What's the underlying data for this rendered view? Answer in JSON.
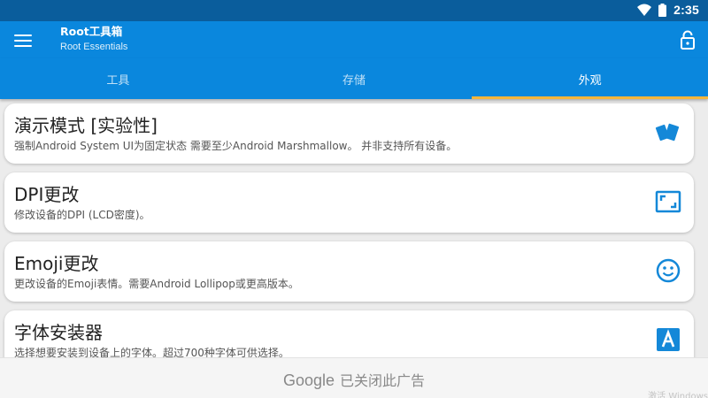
{
  "status": {
    "time": "2:35"
  },
  "app": {
    "title": "Root工具箱",
    "subtitle": "Root Essentials"
  },
  "tabs": [
    {
      "label": "工具",
      "active": false
    },
    {
      "label": "存储",
      "active": false
    },
    {
      "label": "外观",
      "active": true
    }
  ],
  "cards": [
    {
      "title": "演示模式 [实验性]",
      "desc": "强制Android System UI为固定状态 需要至少Android Marshmallow。 并非支持所有设备。",
      "icon": "cards-icon"
    },
    {
      "title": "DPI更改",
      "desc": "修改设备的DPI (LCD密度)。",
      "icon": "screen-resize-icon"
    },
    {
      "title": "Emoji更改",
      "desc": "更改设备的Emoji表情。需要Android Lollipop或更高版本。",
      "icon": "smiley-icon"
    },
    {
      "title": "字体安装器",
      "desc": "选择想要安装到设备上的字体。超过700种字体可供选择。",
      "icon": "font-icon"
    }
  ],
  "ad": {
    "brand": "Google",
    "text": "已关闭此广告"
  },
  "watermark": "激活 Windows",
  "colors": {
    "statusbar": "#0a5d9c",
    "appbar": "#0a87dd",
    "accent": "#f7b63b",
    "icon": "#1488d8"
  }
}
